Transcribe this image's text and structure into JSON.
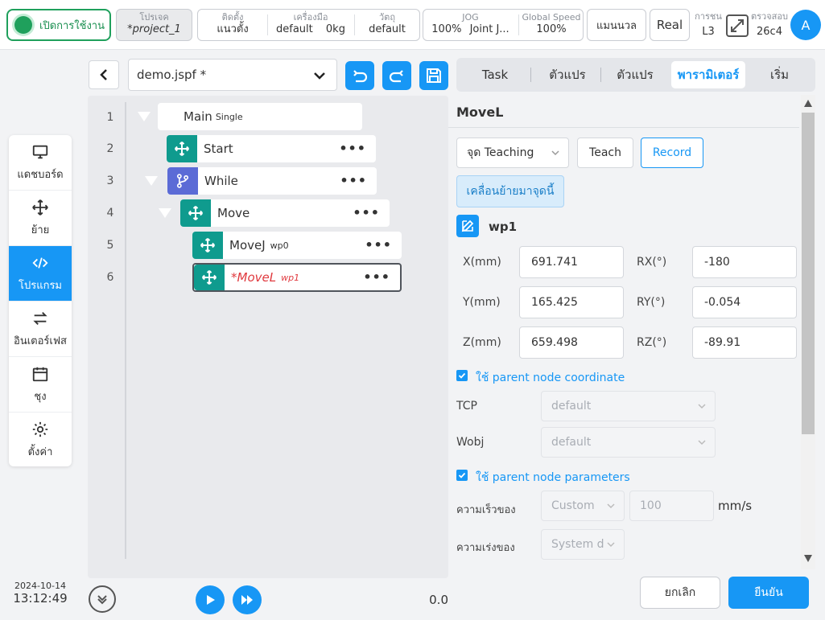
{
  "topbar": {
    "enable_label": "เปิดการใช้งาน",
    "project_caption": "โปรเจค",
    "project_value": "*project_1",
    "install_caption": "ติดตั้ง",
    "install_value": "แนวตั้ง",
    "tool_caption": "เครื่องมือ",
    "tool_value": "default",
    "tool_weight": "0kg",
    "object_caption": "วัตถุ",
    "object_value": "default",
    "jog_caption": "JOG",
    "jog_value": "100%",
    "jog_mode": "Joint J...",
    "speed_caption": "Global Speed",
    "speed_value": "100%",
    "manual_label": "แมนนวล",
    "real_label": "Real",
    "level_caption": "การชน",
    "level_value": "L3",
    "check_caption": "ตรวจสอบ",
    "check_value": "26c4",
    "avatar_letter": "A"
  },
  "nav": {
    "items": [
      {
        "label": "แดชบอร์ด",
        "icon": "monitor-icon"
      },
      {
        "label": "ย้าย",
        "icon": "move-icon"
      },
      {
        "label": "โปรแกรม",
        "icon": "code-icon"
      },
      {
        "label": "อินเตอร์เฟส",
        "icon": "swap-icon"
      },
      {
        "label": "ชุง",
        "icon": "calendar-icon"
      },
      {
        "label": "ตั้งค่า",
        "icon": "gear-icon"
      }
    ],
    "active_index": 2
  },
  "datetime": {
    "date": "2024-10-14",
    "time": "13:12:49"
  },
  "program": {
    "file_name": "demo.jspf *",
    "tree": [
      {
        "line": "1",
        "label": "Main",
        "sub": "Single"
      },
      {
        "line": "2",
        "label": "Start",
        "sub": ""
      },
      {
        "line": "3",
        "label": "While",
        "sub": ""
      },
      {
        "line": "4",
        "label": "Move",
        "sub": ""
      },
      {
        "line": "5",
        "label": "MoveJ",
        "sub": "wp0"
      },
      {
        "line": "6",
        "label": "*MoveL",
        "sub": "wp1"
      }
    ],
    "run_value": "0.0"
  },
  "tabs": [
    "Task",
    "ตัวแปร",
    "ตัวแปร",
    "พารามิเตอร์",
    "เริ่ม"
  ],
  "detail": {
    "title": "MoveL",
    "point_type": "จุด Teaching",
    "teach_label": "Teach",
    "record_label": "Record",
    "move_to_label": "เคลื่อนย้ายมาจุดนี้",
    "waypoint": "wp1",
    "fields": {
      "x_label": "X(mm)",
      "x_value": "691.741",
      "y_label": "Y(mm)",
      "y_value": "165.425",
      "z_label": "Z(mm)",
      "z_value": "659.498",
      "rx_label": "RX(°)",
      "rx_value": "-180",
      "ry_label": "RY(°)",
      "ry_value": "-0.054",
      "rz_label": "RZ(°)",
      "rz_value": "-89.91"
    },
    "parent_coord_label": "ใช้ parent node coordinate",
    "tcp_label": "TCP",
    "tcp_value": "default",
    "wobj_label": "Wobj",
    "wobj_value": "default",
    "parent_param_label": "ใช้ parent node parameters",
    "speed_label": "ความเร็วของ",
    "speed_mode": "Custom",
    "speed_value": "100",
    "speed_unit": "mm/s",
    "accel_label": "ความเร่งของ",
    "accel_mode": "System d"
  },
  "footer": {
    "cancel_label": "ยกเลิก",
    "confirm_label": "ยืนยัน"
  },
  "colors": {
    "accent": "#1797f5",
    "enable_green": "#1fa05c",
    "node_teal": "#0f9b8e",
    "node_purple": "#5b6bd6",
    "error_red": "#e0393e"
  }
}
